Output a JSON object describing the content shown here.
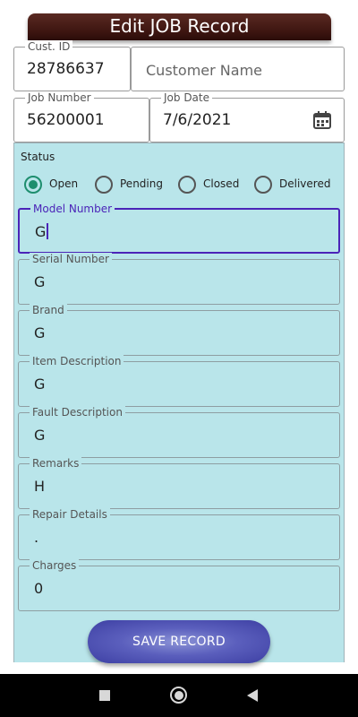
{
  "header": {
    "title": "Edit JOB Record"
  },
  "customer": {
    "id_label": "Cust. ID",
    "id_value": "28786637",
    "name_placeholder": "Customer Name"
  },
  "job": {
    "number_label": "Job Number",
    "number_value": "56200001",
    "date_label": "Job Date",
    "date_value": "7/6/2021"
  },
  "status": {
    "label": "Status",
    "options": [
      "Open",
      "Pending",
      "Closed",
      "Delivered"
    ],
    "selected": "Open"
  },
  "fields": [
    {
      "label": "Model Number",
      "value": "G",
      "focused": true
    },
    {
      "label": "Serial Number",
      "value": "G"
    },
    {
      "label": "Brand",
      "value": "G"
    },
    {
      "label": "Item Description",
      "value": "G"
    },
    {
      "label": "Fault Description",
      "value": "G"
    },
    {
      "label": "Remarks",
      "value": "H"
    },
    {
      "label": "Repair Details",
      "value": "."
    },
    {
      "label": "Charges",
      "value": "0"
    }
  ],
  "actions": {
    "save_label": "SAVE RECORD"
  },
  "colors": {
    "panel": "#b9e5ea",
    "title_bar": "#3c1510",
    "focus": "#4b24b8",
    "radio_selected": "#1e8e6e",
    "button": "#5b5fbd"
  }
}
